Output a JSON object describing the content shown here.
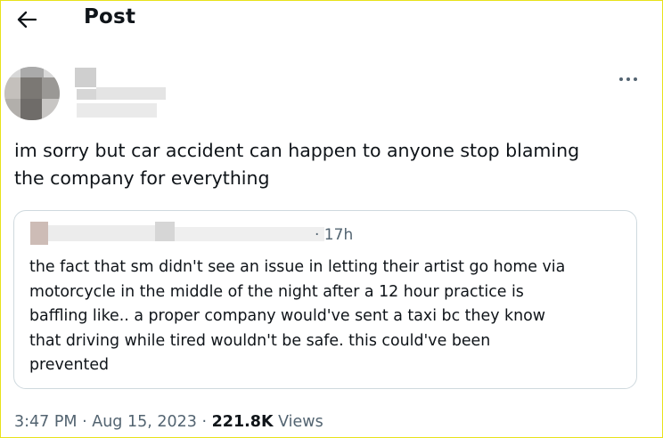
{
  "header": {
    "title": "Post",
    "back_icon": "arrow-left-icon"
  },
  "post": {
    "text_lines": [
      "im sorry but car accident can happen to anyone stop blaming",
      "the company for everything"
    ],
    "more_icon": "more-horizontal-icon",
    "quote": {
      "time": "· 17h",
      "text_lines": [
        "the fact that sm didn't see an issue in letting their artist go home via",
        "motorcycle in the middle of the night after a 12 hour practice is",
        "baffling like.. a proper company would've sent a taxi bc they know",
        "that driving while tired wouldn't be safe. this could've been",
        "prevented"
      ]
    },
    "meta": {
      "time": "3:47 PM",
      "sep1": " · ",
      "date": "Aug 15, 2023",
      "sep2": " · ",
      "views_count": "221.8K",
      "views_label": " Views"
    }
  },
  "colors": {
    "text": "#0f1419",
    "secondary": "#536471",
    "border": "#cfd9de",
    "frame": "#e8e21a"
  }
}
